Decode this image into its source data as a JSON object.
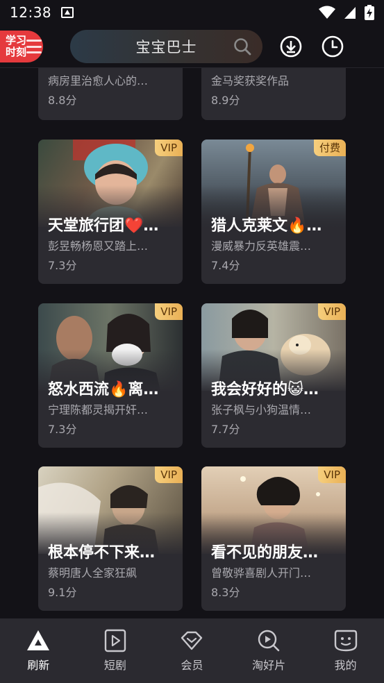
{
  "status_bar": {
    "time": "12:38"
  },
  "header": {
    "badge_line1": "学习",
    "badge_line2": "时刻",
    "search_text": "宝宝巴士"
  },
  "cards": [
    {
      "subtitle": "病房里治愈人心的…",
      "score": "8.8分"
    },
    {
      "subtitle": "金马奖获奖作品",
      "score": "8.9分"
    },
    {
      "tag": "VIP",
      "title": "天堂旅行团❤️…",
      "subtitle": "彭昱畅杨恩又踏上…",
      "score": "7.3分"
    },
    {
      "tag": "付费",
      "title": "猎人克莱文🔥…",
      "subtitle": "漫威暴力反英雄震…",
      "score": "7.4分"
    },
    {
      "tag": "VIP",
      "title": "怒水西流🔥离…",
      "subtitle": "宁理陈都灵揭开奸…",
      "score": "7.3分"
    },
    {
      "tag": "VIP",
      "title": "我会好好的😺…",
      "subtitle": "张子枫与小狗温情…",
      "score": "7.7分"
    },
    {
      "tag": "VIP",
      "title": "根本停不下来…",
      "subtitle": "蔡明唐人全家狂飙",
      "score": "9.1分"
    },
    {
      "tag": "VIP",
      "title": "看不见的朋友…",
      "subtitle": "曾敬骅喜剧人开门…",
      "score": "8.3分"
    }
  ],
  "bottom_nav": [
    {
      "label": "刷新",
      "icon": "refresh-triangle-icon",
      "active": true
    },
    {
      "label": "短剧",
      "icon": "play-square-icon"
    },
    {
      "label": "会员",
      "icon": "diamond-icon"
    },
    {
      "label": "淘好片",
      "icon": "search-play-icon"
    },
    {
      "label": "我的",
      "icon": "smiley-icon"
    }
  ],
  "colors": {
    "background": "#131217",
    "card": "#2c2b31",
    "badge_red": "#e53a3d",
    "vip_gold": "#f0c06a",
    "nav_bg": "#2b2a30"
  }
}
